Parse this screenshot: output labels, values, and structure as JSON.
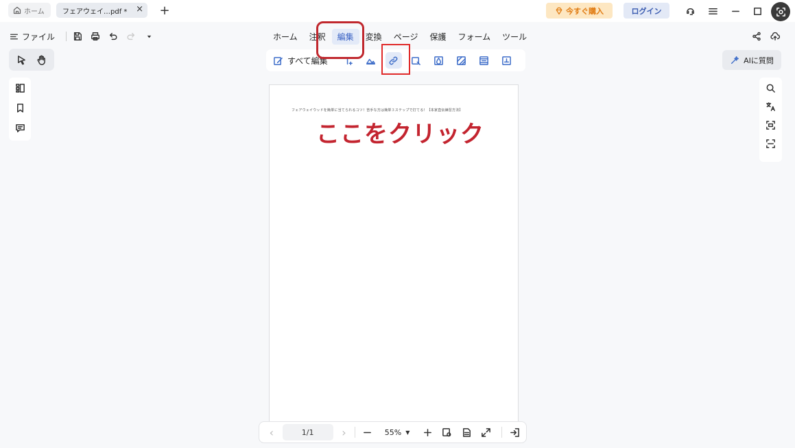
{
  "tabs": {
    "home_label": "ホーム",
    "doc_label": "フェアウェイ…pdf *",
    "close_symbol": "×",
    "new_tab_symbol": "+"
  },
  "titlebar": {
    "buy_label": "今すぐ購入",
    "login_label": "ログイン"
  },
  "file_menu": {
    "label": "ファイル"
  },
  "main_menu": {
    "items": [
      "ホーム",
      "注釈",
      "編集",
      "変換",
      "ページ",
      "保護",
      "フォーム",
      "ツール"
    ],
    "active": "編集"
  },
  "toolbar": {
    "edit_all_label": "すべて編集"
  },
  "ai": {
    "label": "AIに質問"
  },
  "document": {
    "tiny_text": "フェアウェイウッドを簡単に当てられるコツ！苦手な方は簡単３ステップで打てる！【本家直伝練習方法】",
    "big_text": "ここをクリック"
  },
  "bottom": {
    "page_value": "1/1",
    "zoom_value": "55%"
  },
  "colors": {
    "accent": "#3a62c4",
    "annotation_red": "#c0272d",
    "buy_orange": "#e07b12"
  }
}
